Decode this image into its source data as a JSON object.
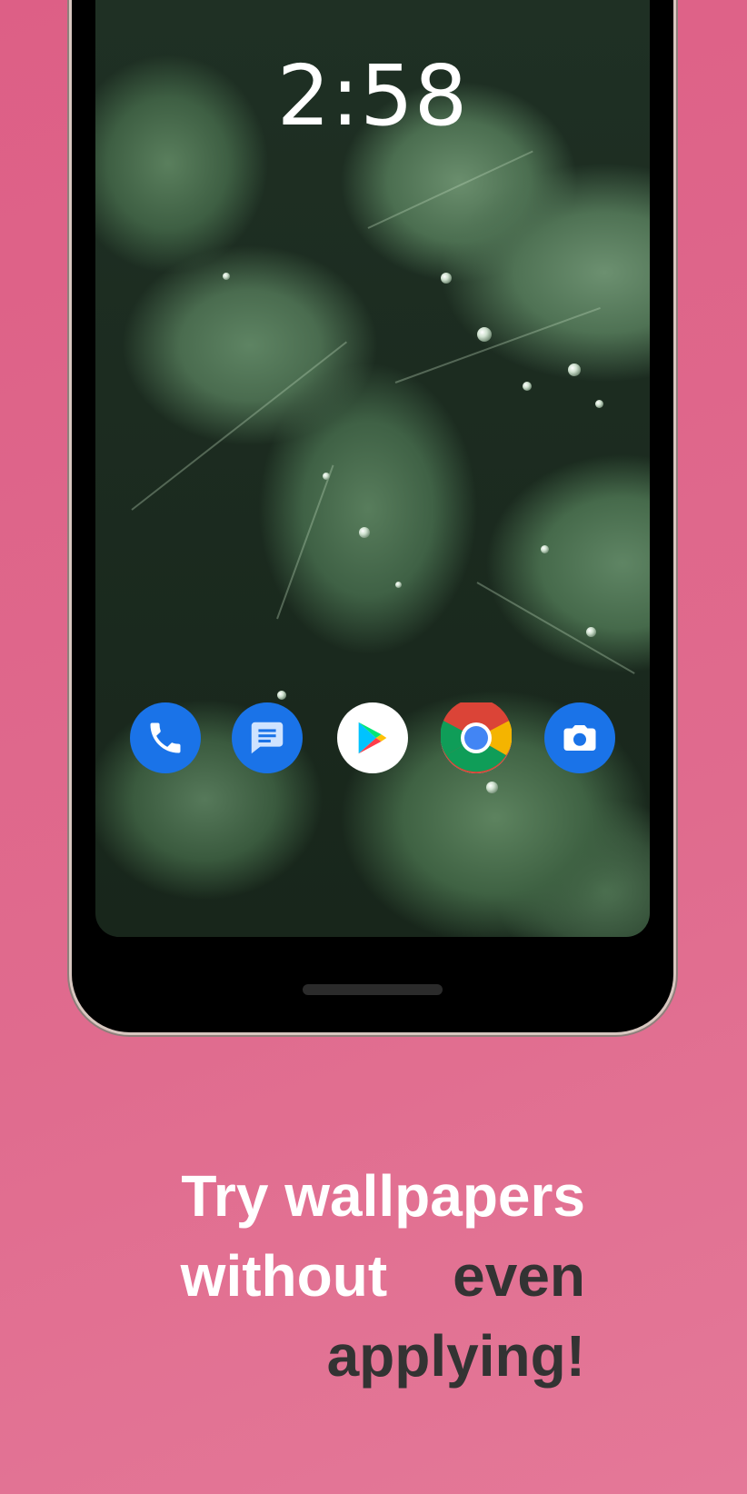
{
  "lockscreen": {
    "time": "2:58"
  },
  "dock": {
    "apps": [
      {
        "name": "Phone",
        "icon": "phone-icon"
      },
      {
        "name": "Messages",
        "icon": "messages-icon"
      },
      {
        "name": "Play Store",
        "icon": "play-store-icon"
      },
      {
        "name": "Chrome",
        "icon": "chrome-icon"
      },
      {
        "name": "Camera",
        "icon": "camera-icon"
      }
    ]
  },
  "caption": {
    "line1": "Try wallpapers",
    "line2_white": "without",
    "line2_dark": "even",
    "line3": "applying!"
  },
  "colors": {
    "background": "#e06b8e",
    "caption_light": "#ffffff",
    "caption_dark": "#333333",
    "app_blue": "#1a73e8"
  }
}
